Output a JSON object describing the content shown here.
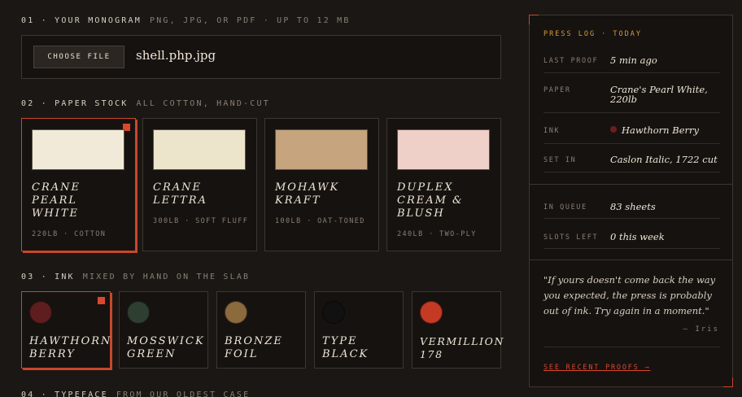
{
  "sections": {
    "monogram": {
      "title": "01 · Your Monogram",
      "subtitle": "PNG, JPG, or PDF · up to 12 MB"
    },
    "paper": {
      "title": "02 · Paper Stock",
      "subtitle": "All cotton, hand-cut"
    },
    "ink": {
      "title": "03 · Ink",
      "subtitle": "Mixed by hand on the slab"
    },
    "typeface": {
      "title": "04 · Typeface",
      "subtitle": "From our oldest case"
    }
  },
  "upload": {
    "button_label": "Choose File",
    "file_name": "shell.php.jpg"
  },
  "papers": [
    {
      "name": "Crane Pearl White",
      "sub": "220lb · Cotton",
      "color": "#f1ead8",
      "selected": true
    },
    {
      "name": "Crane Lettra",
      "sub": "300lb · Soft fluff",
      "color": "#ede4cc",
      "selected": false
    },
    {
      "name": "Mohawk Kraft",
      "sub": "100lb · Oat-toned",
      "color": "#c5a47e",
      "selected": false
    },
    {
      "name": "Duplex Cream & Blush",
      "sub": "240lb · Two-ply",
      "color": "#efd0c8",
      "selected": false
    }
  ],
  "inks": [
    {
      "name": "Hawthorn Berry",
      "color": "#5e1e1e",
      "selected": true
    },
    {
      "name": "Mosswick Green",
      "color": "#2e3e30",
      "selected": false
    },
    {
      "name": "Bronze Foil",
      "color": "#8b6a3e",
      "selected": false
    },
    {
      "name": "Type Black",
      "color": "#111111",
      "selected": false
    },
    {
      "name": "Vermillion 178",
      "color": "#c43a25",
      "selected": false
    }
  ],
  "press_log": {
    "title": "Press Log · Today",
    "rows": [
      {
        "label": "Last Proof",
        "value": "5 min ago"
      },
      {
        "label": "Paper",
        "value": "Crane's Pearl White, 220lb"
      },
      {
        "label": "Ink",
        "value": "Hawthorn Berry"
      },
      {
        "label": "Set In",
        "value": "Caslon Italic, 1722 cut"
      },
      {
        "label": "In Queue",
        "value": "83 sheets"
      },
      {
        "label": "Slots Left",
        "value": "0 this week"
      }
    ],
    "quote": "\"If yours doesn't come back the way you expected, the press is probably out of ink. Try again in a moment.\"",
    "attribution": "— Iris",
    "link_label": "See recent proofs →"
  },
  "colors": {
    "accent": "#c9472c",
    "gold": "#d89a3a",
    "background": "#1b1714"
  }
}
